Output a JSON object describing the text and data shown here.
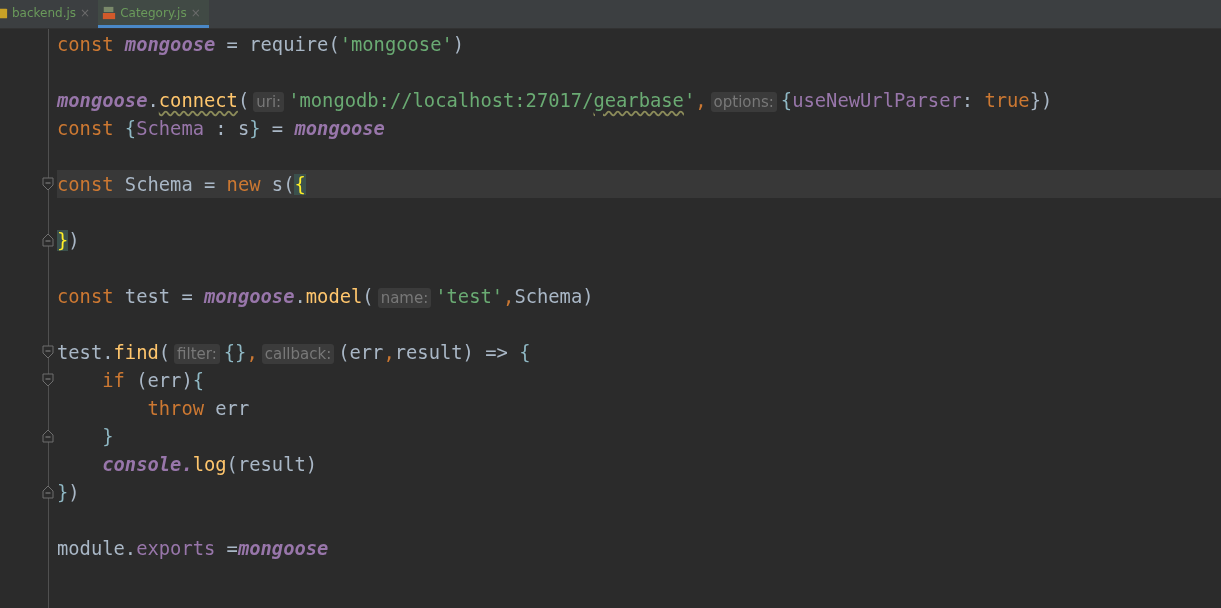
{
  "tabs": [
    {
      "label": "backend.js",
      "close": "×",
      "selected": false
    },
    {
      "label": "Category.js",
      "close": "×",
      "selected": true
    }
  ],
  "editor": {
    "lines": [
      {
        "current": false,
        "tokens": [
          {
            "t": "const ",
            "kind": "kw"
          },
          {
            "t": "mongoose",
            "kind": "ivar"
          },
          {
            "t": " = require(",
            "kind": "plain"
          },
          {
            "t": "'mongoose'",
            "kind": "str"
          },
          {
            "t": ")",
            "kind": "plain"
          }
        ]
      },
      {
        "current": false
      },
      {
        "current": false,
        "tokens": [
          {
            "t": "mongoose",
            "kind": "ivar"
          },
          {
            "t": ".",
            "kind": "plain"
          },
          {
            "t": "connect",
            "kind": "fn",
            "typo": true
          },
          {
            "t": "(",
            "kind": "plain"
          },
          {
            "t": "uri:",
            "kind": "hint"
          },
          {
            "t": "'mongodb://localhost:27017/",
            "kind": "str"
          },
          {
            "t": "gearbase",
            "kind": "str",
            "typo": true
          },
          {
            "t": "'",
            "kind": "str"
          },
          {
            "t": ",",
            "kind": "comma"
          },
          {
            "t": "options:",
            "kind": "hint"
          },
          {
            "t": "{",
            "kind": "brace"
          },
          {
            "t": "useNewUrlParser",
            "kind": "field"
          },
          {
            "t": ": ",
            "kind": "plain"
          },
          {
            "t": "true",
            "kind": "kw"
          },
          {
            "t": "})",
            "kind": "plain"
          }
        ]
      },
      {
        "current": false,
        "tokens": [
          {
            "t": "const ",
            "kind": "kw"
          },
          {
            "t": "{",
            "kind": "brace"
          },
          {
            "t": "Schema",
            "kind": "field"
          },
          {
            "t": " : s",
            "kind": "plain"
          },
          {
            "t": "}",
            "kind": "brace"
          },
          {
            "t": " = ",
            "kind": "plain"
          },
          {
            "t": "mongoose",
            "kind": "ivar"
          }
        ]
      },
      {
        "current": false
      },
      {
        "current": true,
        "fold_marker": {
          "kind": "start"
        },
        "tokens": [
          {
            "t": "const ",
            "kind": "kw"
          },
          {
            "t": "Schema = ",
            "kind": "plain"
          },
          {
            "t": "new ",
            "kind": "kw"
          },
          {
            "t": "s(",
            "kind": "plain"
          },
          {
            "t": "{",
            "kind": "match"
          }
        ]
      },
      {
        "current": false
      },
      {
        "current": false,
        "fold_marker": {
          "kind": "end"
        },
        "tokens": [
          {
            "t": "}",
            "kind": "match"
          },
          {
            "t": ")",
            "kind": "plain"
          }
        ]
      },
      {
        "current": false
      },
      {
        "current": false,
        "tokens": [
          {
            "t": "const ",
            "kind": "kw"
          },
          {
            "t": "test = ",
            "kind": "plain"
          },
          {
            "t": "mongoose",
            "kind": "ivar"
          },
          {
            "t": ".",
            "kind": "plain"
          },
          {
            "t": "model",
            "kind": "fn"
          },
          {
            "t": "(",
            "kind": "plain"
          },
          {
            "t": "name:",
            "kind": "hint"
          },
          {
            "t": "'test'",
            "kind": "str"
          },
          {
            "t": ",",
            "kind": "comma"
          },
          {
            "t": "Schema)",
            "kind": "plain"
          }
        ]
      },
      {
        "current": false
      },
      {
        "current": false,
        "fold_marker": {
          "kind": "start"
        },
        "tokens": [
          {
            "t": "test.",
            "kind": "plain"
          },
          {
            "t": "find",
            "kind": "fn"
          },
          {
            "t": "(",
            "kind": "plain"
          },
          {
            "t": "filter:",
            "kind": "hint"
          },
          {
            "t": "{}",
            "kind": "brace"
          },
          {
            "t": ",",
            "kind": "comma"
          },
          {
            "t": "callback:",
            "kind": "hint"
          },
          {
            "t": "(err",
            "kind": "plain"
          },
          {
            "t": ",",
            "kind": "comma"
          },
          {
            "t": "result) => ",
            "kind": "plain"
          },
          {
            "t": "{",
            "kind": "brace"
          }
        ]
      },
      {
        "current": false,
        "fold_marker": {
          "kind": "start"
        },
        "tokens": [
          {
            "t": "    if ",
            "kind": "kw"
          },
          {
            "t": "(err)",
            "kind": "plain"
          },
          {
            "t": "{",
            "kind": "brace"
          }
        ]
      },
      {
        "current": false,
        "tokens": [
          {
            "t": "        throw ",
            "kind": "kw"
          },
          {
            "t": "err",
            "kind": "plain"
          }
        ]
      },
      {
        "current": false,
        "fold_marker": {
          "kind": "end"
        },
        "tokens": [
          {
            "t": "    }",
            "kind": "brace"
          }
        ]
      },
      {
        "current": false,
        "tokens": [
          {
            "t": "    console.",
            "kind": "ivar"
          },
          {
            "t": "log",
            "kind": "fn"
          },
          {
            "t": "(result)",
            "kind": "plain"
          }
        ]
      },
      {
        "current": false,
        "fold_marker": {
          "kind": "end"
        },
        "tokens": [
          {
            "t": "}",
            "kind": "brace"
          },
          {
            "t": ")",
            "kind": "plain"
          }
        ]
      },
      {
        "current": false
      },
      {
        "current": false,
        "tokens": [
          {
            "t": "module.",
            "kind": "plain"
          },
          {
            "t": "exports",
            "kind": "field"
          },
          {
            "t": " =",
            "kind": "plain"
          },
          {
            "t": "mongoose",
            "kind": "ivar"
          }
        ]
      }
    ]
  }
}
